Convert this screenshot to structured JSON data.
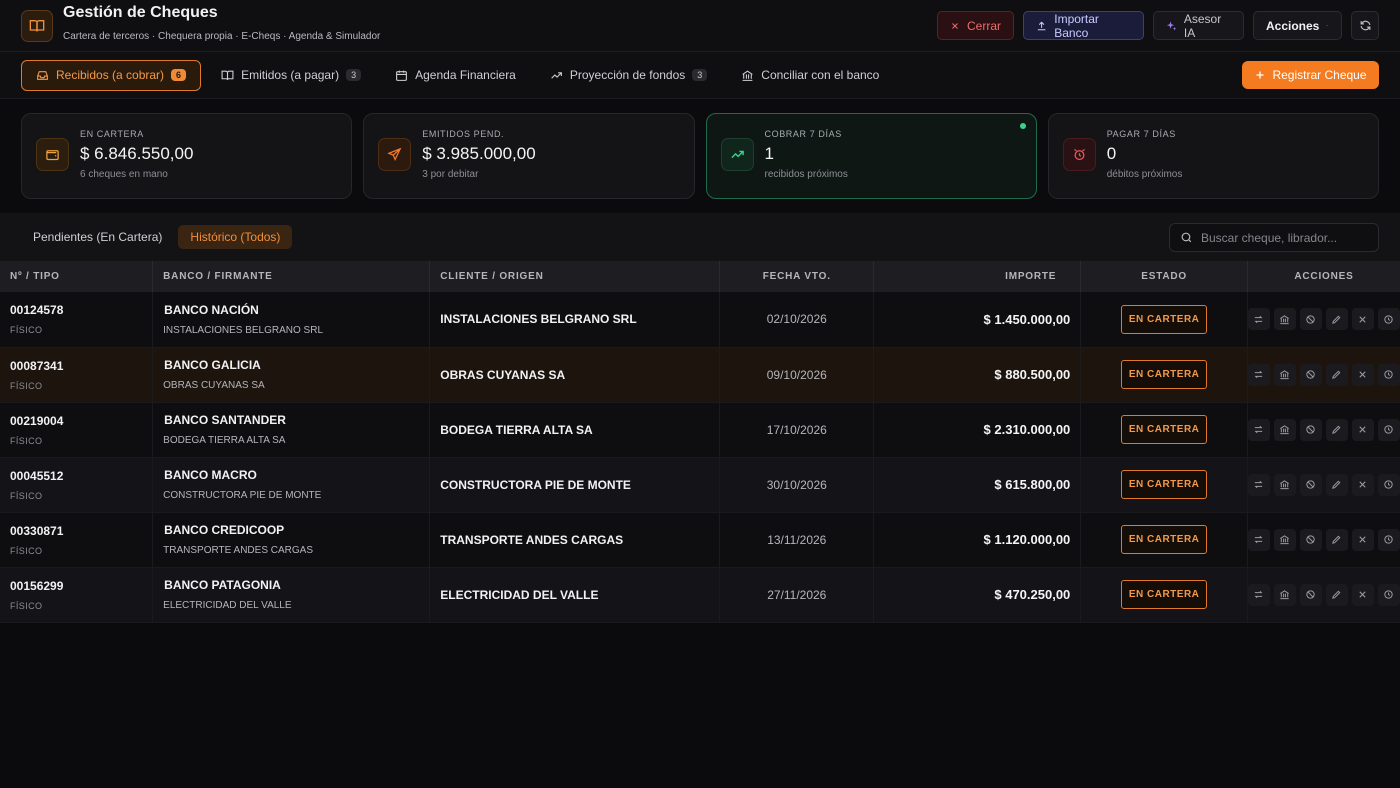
{
  "header": {
    "title": "Gestión de Cheques",
    "subtitle": "Cartera de terceros · Chequera propia · E-Cheqs · Agenda & Simulador",
    "close_label": "Cerrar",
    "import_label": "Importar Banco",
    "ai_label": "Asesor IA",
    "actions_label": "Acciones"
  },
  "tabs": [
    {
      "label": "Recibidos (a cobrar)",
      "badge": "6"
    },
    {
      "label": "Emitidos (a pagar)",
      "badge": "3"
    },
    {
      "label": "Agenda Financiera"
    },
    {
      "label": "Proyección de fondos",
      "badge": "3"
    },
    {
      "label": "Conciliar con el banco"
    }
  ],
  "register_label": "Registrar Cheque",
  "stats": [
    {
      "label": "EN CARTERA",
      "value": "$ 6.846.550,00",
      "sub": "6 cheques en mano"
    },
    {
      "label": "EMITIDOS PEND.",
      "value": "$ 3.985.000,00",
      "sub": "3 por debitar"
    },
    {
      "label": "COBRAR 7 DÍAS",
      "value": "1",
      "sub": "recibidos próximos"
    },
    {
      "label": "PAGAR 7 DÍAS",
      "value": "0",
      "sub": "débitos próximos"
    }
  ],
  "filters": {
    "pending": "Pendientes (En Cartera)",
    "history": "Histórico (Todos)"
  },
  "search": {
    "placeholder": "Buscar cheque, librador..."
  },
  "table": {
    "headers": [
      "Nº / TIPO",
      "BANCO / FIRMANTE",
      "CLIENTE / ORIGEN",
      "FECHA VTO.",
      "IMPORTE",
      "ESTADO",
      "ACCIONES"
    ],
    "rows": [
      {
        "num": "00124578",
        "type": "FÍSICO",
        "bank": "BANCO NACIÓN",
        "signer": "INSTALACIONES BELGRANO SRL",
        "client": "INSTALACIONES BELGRANO SRL",
        "date": "02/10/2026",
        "amount": "$ 1.450.000,00",
        "status": "EN CARTERA"
      },
      {
        "num": "00087341",
        "type": "FÍSICO",
        "bank": "BANCO GALICIA",
        "signer": "OBRAS CUYANAS SA",
        "client": "OBRAS CUYANAS SA",
        "date": "09/10/2026",
        "amount": "$ 880.500,00",
        "status": "EN CARTERA"
      },
      {
        "num": "00219004",
        "type": "FÍSICO",
        "bank": "BANCO SANTANDER",
        "signer": "BODEGA TIERRA ALTA SA",
        "client": "BODEGA TIERRA ALTA SA",
        "date": "17/10/2026",
        "amount": "$ 2.310.000,00",
        "status": "EN CARTERA"
      },
      {
        "num": "00045512",
        "type": "FÍSICO",
        "bank": "BANCO MACRO",
        "signer": "CONSTRUCTORA PIE DE MONTE",
        "client": "CONSTRUCTORA PIE DE MONTE",
        "date": "30/10/2026",
        "amount": "$ 615.800,00",
        "status": "EN CARTERA"
      },
      {
        "num": "00330871",
        "type": "FÍSICO",
        "bank": "BANCO CREDICOOP",
        "signer": "TRANSPORTE ANDES CARGAS",
        "client": "TRANSPORTE ANDES CARGAS",
        "date": "13/11/2026",
        "amount": "$ 1.120.000,00",
        "status": "EN CARTERA"
      },
      {
        "num": "00156299",
        "type": "FÍSICO",
        "bank": "BANCO PATAGONIA",
        "signer": "ELECTRICIDAD DEL VALLE",
        "client": "ELECTRICIDAD DEL VALLE",
        "date": "27/11/2026",
        "amount": "$ 470.250,00",
        "status": "EN CARTERA"
      }
    ]
  },
  "colors": {
    "accent": "#f47b20",
    "success": "#3bd38a",
    "danger": "#f05a5a",
    "background": "#0b0b0d"
  }
}
